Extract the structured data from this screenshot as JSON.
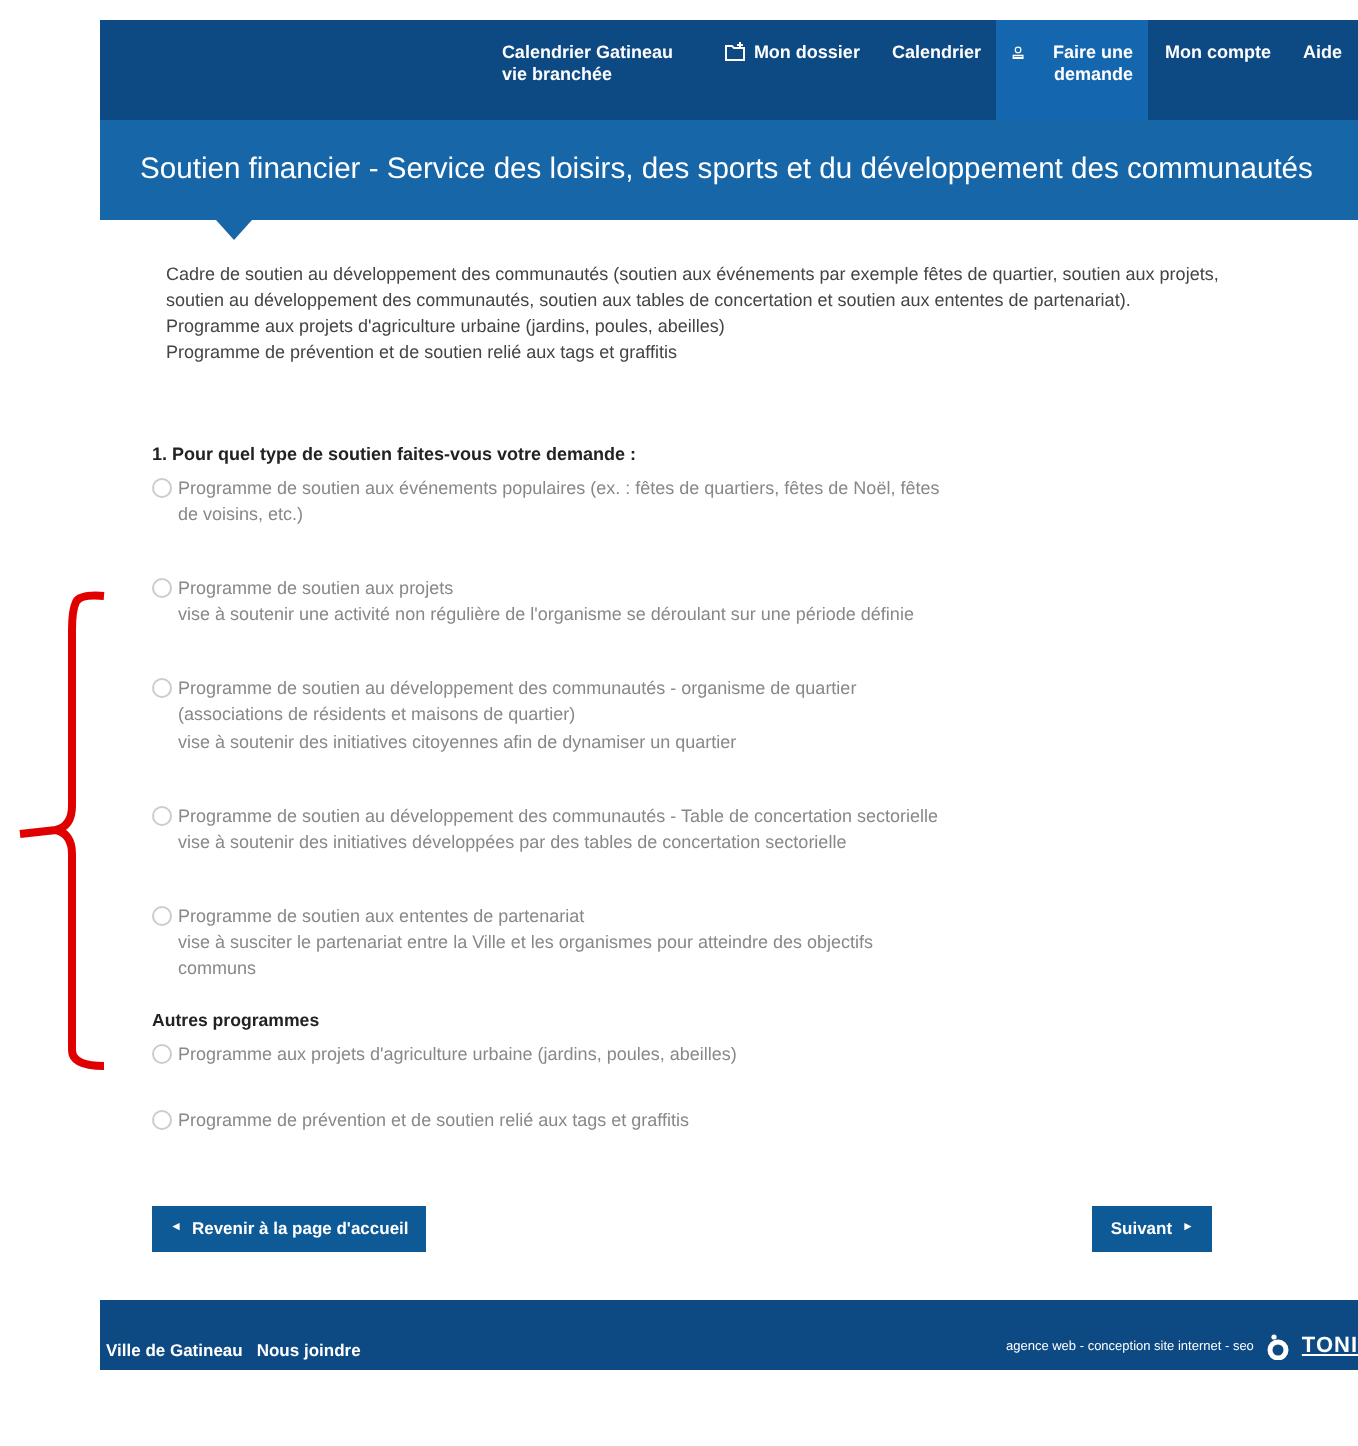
{
  "nav": [
    {
      "label": "Calendrier Gatineau vie branchée",
      "kind": "text",
      "selected": false
    },
    {
      "label": "Mon dossier",
      "kind": "folder",
      "selected": false
    },
    {
      "label": "Calendrier",
      "kind": "text",
      "selected": false
    },
    {
      "label": "Faire une demande",
      "kind": "person",
      "selected": true
    },
    {
      "label": "Mon compte",
      "kind": "text",
      "selected": false
    },
    {
      "label": "Aide",
      "kind": "text",
      "selected": false
    }
  ],
  "page_title": "Soutien financier - Service des loisirs, des sports et du développement des communautés",
  "intro": [
    "Cadre de soutien au développement des communautés (soutien aux événements par exemple fêtes de quartier, soutien aux projets, soutien au développement des communautés, soutien aux tables de concertation et soutien aux ententes de partenariat).",
    "Programme aux projets d'agriculture urbaine (jardins, poules, abeilles)",
    "Programme de prévention et de soutien relié aux tags et graffitis"
  ],
  "question": "1. Pour quel type de soutien faites-vous votre demande :",
  "options": [
    {
      "lines": [
        "Programme de soutien aux événements populaires (ex. : fêtes de quartiers, fêtes de Noël, fêtes de voisins, etc.)"
      ],
      "selected": false
    },
    {
      "lines": [
        "Programme de soutien aux projets",
        "vise à soutenir une activité non régulière de l'organisme se déroulant sur une période définie"
      ],
      "selected": false
    },
    {
      "lines": [
        "Programme de soutien au développement des communautés - organisme de quartier (associations de résidents et maisons de quartier)",
        "vise à soutenir des initiatives citoyennes afin de dynamiser un quartier"
      ],
      "selected": false
    },
    {
      "lines": [
        "Programme de soutien au développement des communautés - Table de concertation sectorielle",
        "vise à soutenir des initiatives développées par des tables de concertation sectorielle"
      ],
      "selected": false
    },
    {
      "lines": [
        "Programme de soutien aux ententes de partenariat",
        "vise à susciter le partenariat entre la Ville et les organismes pour atteindre des objectifs communs"
      ],
      "selected": false
    }
  ],
  "other_heading": "Autres programmes",
  "other_options": [
    {
      "lines": [
        "Programme aux projets d'agriculture urbaine (jardins, poules, abeilles)"
      ],
      "selected": false
    },
    {
      "lines": [
        "Programme de prévention et de soutien relié aux tags et graffitis"
      ],
      "selected": false
    }
  ],
  "back_button": {
    "arrow": "◄",
    "label": "Revenir à la page d'accueil"
  },
  "next_button": {
    "arrow": "►",
    "label": "Suivant"
  },
  "footer": {
    "links": [
      "Ville de Gatineau",
      "Nous joindre"
    ],
    "credit": "agence web - conception site internet - seo",
    "logo": "TONI"
  }
}
